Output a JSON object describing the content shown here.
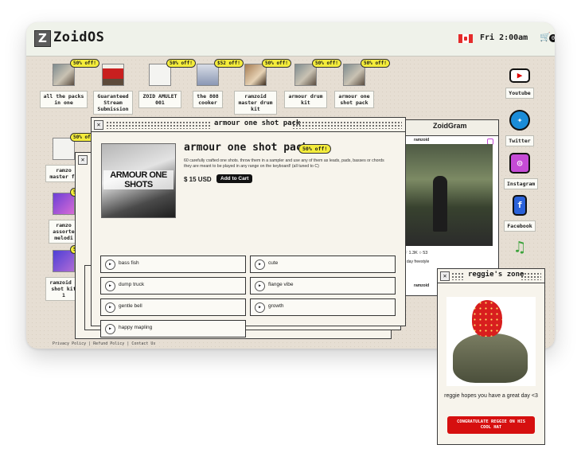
{
  "topbar": {
    "app_name": "ZoidOS",
    "logo_letter": "Z",
    "time": "Fri 2:00am",
    "cart_count": "0"
  },
  "desktop": {
    "top_row": [
      {
        "label": "all the packs\nin one",
        "badge": "50% off!"
      },
      {
        "label": "Guaranteed\nStream\nSubmission",
        "badge": ""
      },
      {
        "label": "ZOID AMULET\n001",
        "badge": "50% off!"
      },
      {
        "label": "the 808\ncooker",
        "badge": "$52 off!"
      },
      {
        "label": "ramzoid\nmaster drum\nkit",
        "badge": "50% off!"
      },
      {
        "label": "armour drum\nkit",
        "badge": "50% off!"
      },
      {
        "label": "armour one\nshot pack",
        "badge": "50% off!"
      }
    ],
    "left_col": [
      {
        "label": "ramzo\nmaster fu",
        "badge": "50% off!"
      },
      {
        "label": "ramzo\nassorte\nmelodi",
        "badge": "50"
      },
      {
        "label": "ramzoid d\nshot kit \n1",
        "badge": "50"
      }
    ],
    "social": [
      {
        "label": "Youtube",
        "glyph": "▶"
      },
      {
        "label": "Twitter",
        "glyph": "✦"
      },
      {
        "label": "Instagram",
        "glyph": "◎"
      },
      {
        "label": "Facebook",
        "glyph": "f"
      },
      {
        "label": "",
        "glyph": "♫"
      }
    ],
    "footer": "Privacy Policy | Refund Policy | Contact Us"
  },
  "product_window": {
    "title": "armour one shot pack",
    "heading": "armour one shot pack",
    "badge": "50% off!",
    "description": "60 carefully crafted one shots. throw them in a sampler and use any of them as leads, pads, basses or chords they are meant to be played in any range on the keyboard! (all tuned to C)",
    "price": "$ 15 USD",
    "add_to_cart": "Add to Cart",
    "image_text": "ARMOUR ONE SHOTS",
    "samples": [
      "bass fish",
      "cute",
      "dump truck",
      "flange vibe",
      "gentle bell",
      "growth",
      "happy mapling"
    ]
  },
  "zoidgram": {
    "title": "ZoidGram",
    "user": "ramzoid",
    "likes": "1.3K",
    "comments": "53",
    "caption": "y day freestyle"
  },
  "reggie": {
    "title": "reggie's zone",
    "message": "reggie hopes you have a great day <3",
    "button": "CONGRATULATE REGGIE ON HIS COOL HAT"
  },
  "colors": {
    "badge": "#f4ec3b",
    "accent_red": "#d60f0f",
    "background": "#e6ded3"
  }
}
